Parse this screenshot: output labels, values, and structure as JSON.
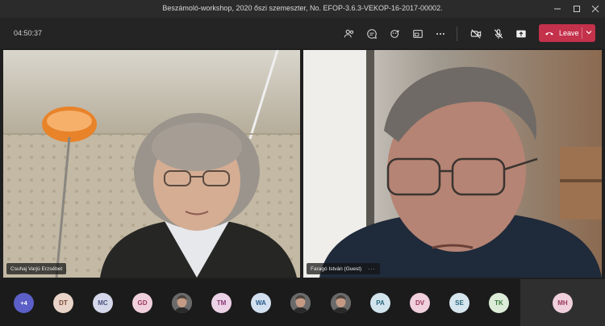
{
  "window": {
    "title": "Beszámoló-workshop, 2020 őszi szemeszter, No. EFOP-3.6.3-VEKOP-16-2017-00002."
  },
  "controls": {
    "timer": "04:50:37",
    "leave_label": "Leave",
    "buttons": [
      "people-icon",
      "chat-icon",
      "reactions-icon",
      "share-tray-icon",
      "more-icon",
      "camera-off-icon",
      "mic-off-icon",
      "share-icon"
    ]
  },
  "participants_main": [
    {
      "name": "Csuhaj Varjú Erzsébet"
    },
    {
      "name": "Faragó István (Guest)",
      "more": "···"
    }
  ],
  "strip": {
    "overflow": "+4",
    "avatars": [
      {
        "initials": "DT",
        "bg": "#e8d4c8",
        "fg": "#7a4a3a"
      },
      {
        "initials": "MC",
        "bg": "#d5d8ea",
        "fg": "#4a5280"
      },
      {
        "initials": "GD",
        "bg": "#f0d0dc",
        "fg": "#9a3a5a"
      },
      {
        "initials": "",
        "photo": true
      },
      {
        "initials": "TM",
        "bg": "#ecd2e6",
        "fg": "#8a3a7a"
      },
      {
        "initials": "WA",
        "bg": "#d2e0f0",
        "fg": "#2a5a8a"
      },
      {
        "initials": "",
        "photo": true
      },
      {
        "initials": "",
        "photo": true
      },
      {
        "initials": "PA",
        "bg": "#d2e4ec",
        "fg": "#2a6a80"
      },
      {
        "initials": "DV",
        "bg": "#f0d0dc",
        "fg": "#9a3a5a"
      },
      {
        "initials": "SE",
        "bg": "#d6e6ee",
        "fg": "#2a6a80"
      },
      {
        "initials": "TK",
        "bg": "#dcecd8",
        "fg": "#3a7a3a"
      },
      {
        "initials": "MH",
        "bg": "#f0d0dc",
        "fg": "#9a3a5a"
      }
    ]
  },
  "colors": {
    "leave": "#c4314b",
    "overflow_badge": "#5b5fc7"
  }
}
